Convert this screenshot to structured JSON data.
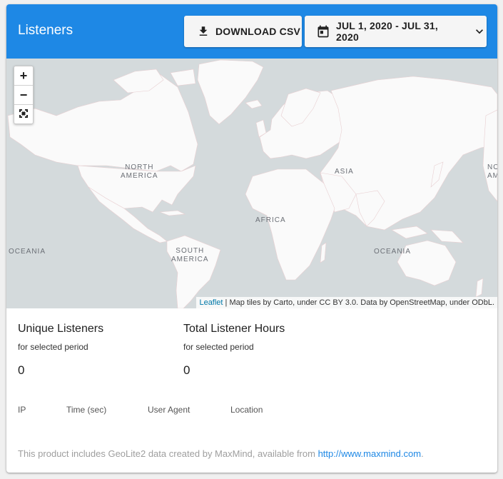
{
  "header": {
    "title": "Listeners",
    "download_label": "DOWNLOAD CSV",
    "date_range": "JUL 1, 2020 - JUL 31, 2020",
    "accent": "#1e88e5"
  },
  "map": {
    "zoom_in": "+",
    "zoom_out": "−",
    "labels": {
      "north_america": "NORTH\nAMERICA",
      "asia": "ASIA",
      "africa": "AFRICA",
      "south_america": "SOUTH\nAMERICA",
      "oceania_left": "OCEANIA",
      "oceania_right": "OCEANIA",
      "edge_label": "NO\nAM"
    },
    "attribution": {
      "link": "Leaflet",
      "text": " | Map tiles by Carto, under CC BY 3.0. Data by OpenStreetMap, under ODbL."
    },
    "water_color": "#d4dadc",
    "land_color": "#fafafa"
  },
  "stats": {
    "unique": {
      "title": "Unique Listeners",
      "subtitle": "for selected period",
      "value": "0"
    },
    "hours": {
      "title": "Total Listener Hours",
      "subtitle": "for selected period",
      "value": "0"
    }
  },
  "table": {
    "columns": [
      "IP",
      "Time (sec)",
      "User Agent",
      "Location"
    ]
  },
  "footer": {
    "text": "This product includes GeoLite2 data created by MaxMind, available from ",
    "link": "http://www.maxmind.com",
    "end": "."
  }
}
